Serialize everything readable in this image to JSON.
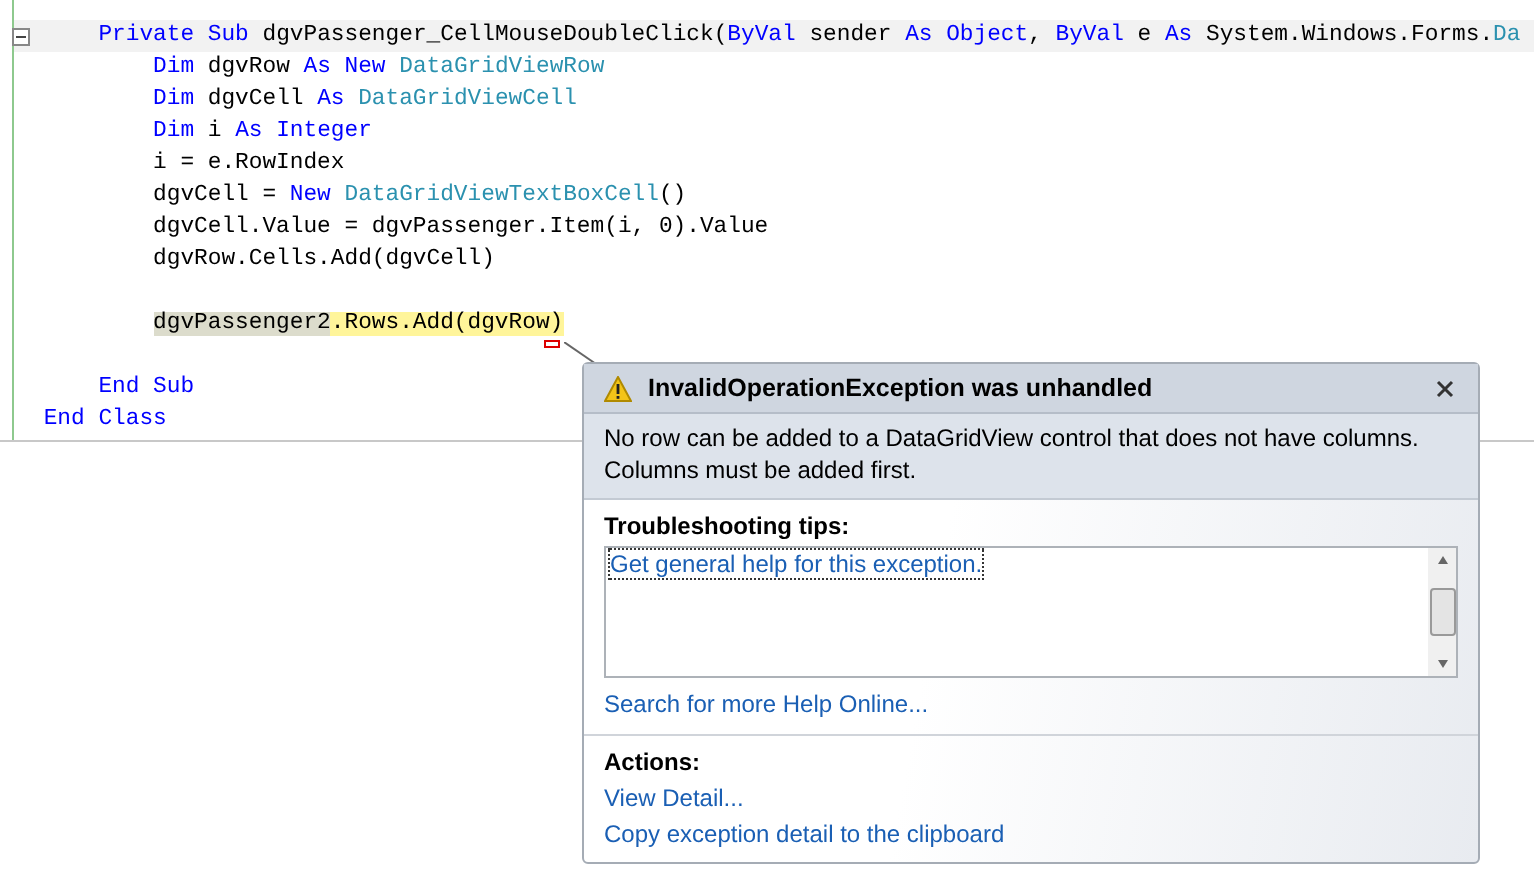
{
  "code_lines": [
    {
      "kind": "code",
      "highlighted": true,
      "collapsible": true,
      "tokens": [
        {
          "text": "    Private",
          "kind": "keyword"
        },
        {
          "text": " Sub",
          "kind": "keyword"
        },
        {
          "text": " dgvPassenger_CellMouseDoubleClick(",
          "kind": "plain"
        },
        {
          "text": "ByVal",
          "kind": "keyword"
        },
        {
          "text": " sender ",
          "kind": "plain"
        },
        {
          "text": "As",
          "kind": "keyword"
        },
        {
          "text": " Object",
          "kind": "keyword"
        },
        {
          "text": ", ",
          "kind": "plain"
        },
        {
          "text": "ByVal",
          "kind": "keyword"
        },
        {
          "text": " e ",
          "kind": "plain"
        },
        {
          "text": "As",
          "kind": "keyword"
        },
        {
          "text": " System.Windows.Forms.",
          "kind": "plain"
        },
        {
          "text": "Da",
          "kind": "type"
        }
      ]
    },
    {
      "kind": "code",
      "highlighted": false,
      "collapsible": false,
      "tokens": [
        {
          "text": "        Dim",
          "kind": "keyword"
        },
        {
          "text": " dgvRow ",
          "kind": "plain"
        },
        {
          "text": "As",
          "kind": "keyword"
        },
        {
          "text": " New",
          "kind": "keyword"
        },
        {
          "text": " DataGridViewRow",
          "kind": "type"
        }
      ]
    },
    {
      "kind": "code",
      "highlighted": false,
      "collapsible": false,
      "tokens": [
        {
          "text": "        Dim",
          "kind": "keyword"
        },
        {
          "text": " dgvCell ",
          "kind": "plain"
        },
        {
          "text": "As",
          "kind": "keyword"
        },
        {
          "text": " DataGridViewCell",
          "kind": "type"
        }
      ]
    },
    {
      "kind": "code",
      "highlighted": false,
      "collapsible": false,
      "tokens": [
        {
          "text": "        Dim",
          "kind": "keyword"
        },
        {
          "text": " i ",
          "kind": "plain"
        },
        {
          "text": "As",
          "kind": "keyword"
        },
        {
          "text": " Integer",
          "kind": "keyword"
        }
      ]
    },
    {
      "kind": "code",
      "highlighted": false,
      "collapsible": false,
      "tokens": [
        {
          "text": "        i = e.RowIndex",
          "kind": "plain"
        }
      ]
    },
    {
      "kind": "code",
      "highlighted": false,
      "collapsible": false,
      "tokens": [
        {
          "text": "        dgvCell = ",
          "kind": "plain"
        },
        {
          "text": "New",
          "kind": "keyword"
        },
        {
          "text": " DataGridViewTextBoxCell",
          "kind": "type"
        },
        {
          "text": "()",
          "kind": "plain"
        }
      ]
    },
    {
      "kind": "code",
      "highlighted": false,
      "collapsible": false,
      "tokens": [
        {
          "text": "        dgvCell.Value = dgvPassenger.Item(i, 0).Value",
          "kind": "plain"
        }
      ]
    },
    {
      "kind": "code",
      "highlighted": false,
      "collapsible": false,
      "tokens": [
        {
          "text": "        dgvRow.Cells.Add(dgvCell)",
          "kind": "plain"
        }
      ]
    },
    {
      "kind": "blank"
    },
    {
      "kind": "code",
      "highlighted": false,
      "collapsible": false,
      "tokens": [
        {
          "text": "        dgvPassenger2",
          "kind": "statement"
        },
        {
          "text": ".Rows.Add(dgvRow)",
          "kind": "current"
        }
      ]
    },
    {
      "kind": "blank"
    },
    {
      "kind": "code",
      "highlighted": false,
      "collapsible": false,
      "tokens": [
        {
          "text": "    End",
          "kind": "keyword"
        },
        {
          "text": " Sub",
          "kind": "keyword"
        }
      ]
    },
    {
      "kind": "code",
      "highlighted": false,
      "collapsible": false,
      "tokens": [
        {
          "text": "End",
          "kind": "keyword"
        },
        {
          "text": " Class",
          "kind": "keyword"
        }
      ]
    }
  ],
  "exception": {
    "title": "InvalidOperationException was unhandled",
    "message": "No row can be added to a DataGridView control that does not have columns. Columns must be added first.",
    "tips_heading": "Troubleshooting tips:",
    "tips": [
      "Get general help for this exception."
    ],
    "search_link": "Search for more Help Online...",
    "actions_heading": "Actions:",
    "actions": [
      "View Detail...",
      "Copy exception detail to the clipboard"
    ]
  }
}
